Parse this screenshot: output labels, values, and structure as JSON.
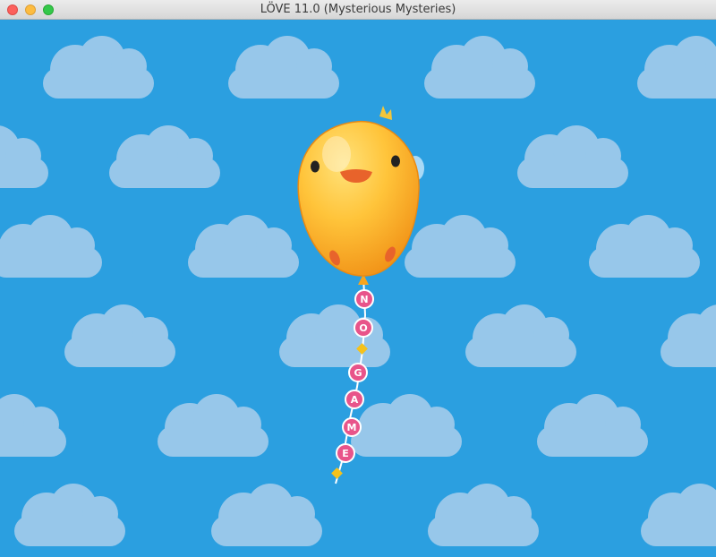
{
  "window": {
    "title": "LÖVE 11.0 (Mysterious Mysteries)"
  },
  "game": {
    "background_color": "#2b9fe0",
    "cloud_color": "#97c7ea",
    "balloon": {
      "character": "duck-balloon",
      "body_color": "#f7a51e",
      "beak_color": "#e8632b"
    },
    "tail_letters": [
      "N",
      "O",
      "G",
      "A",
      "M",
      "E"
    ],
    "letter_badge_color": "#e8548a"
  }
}
